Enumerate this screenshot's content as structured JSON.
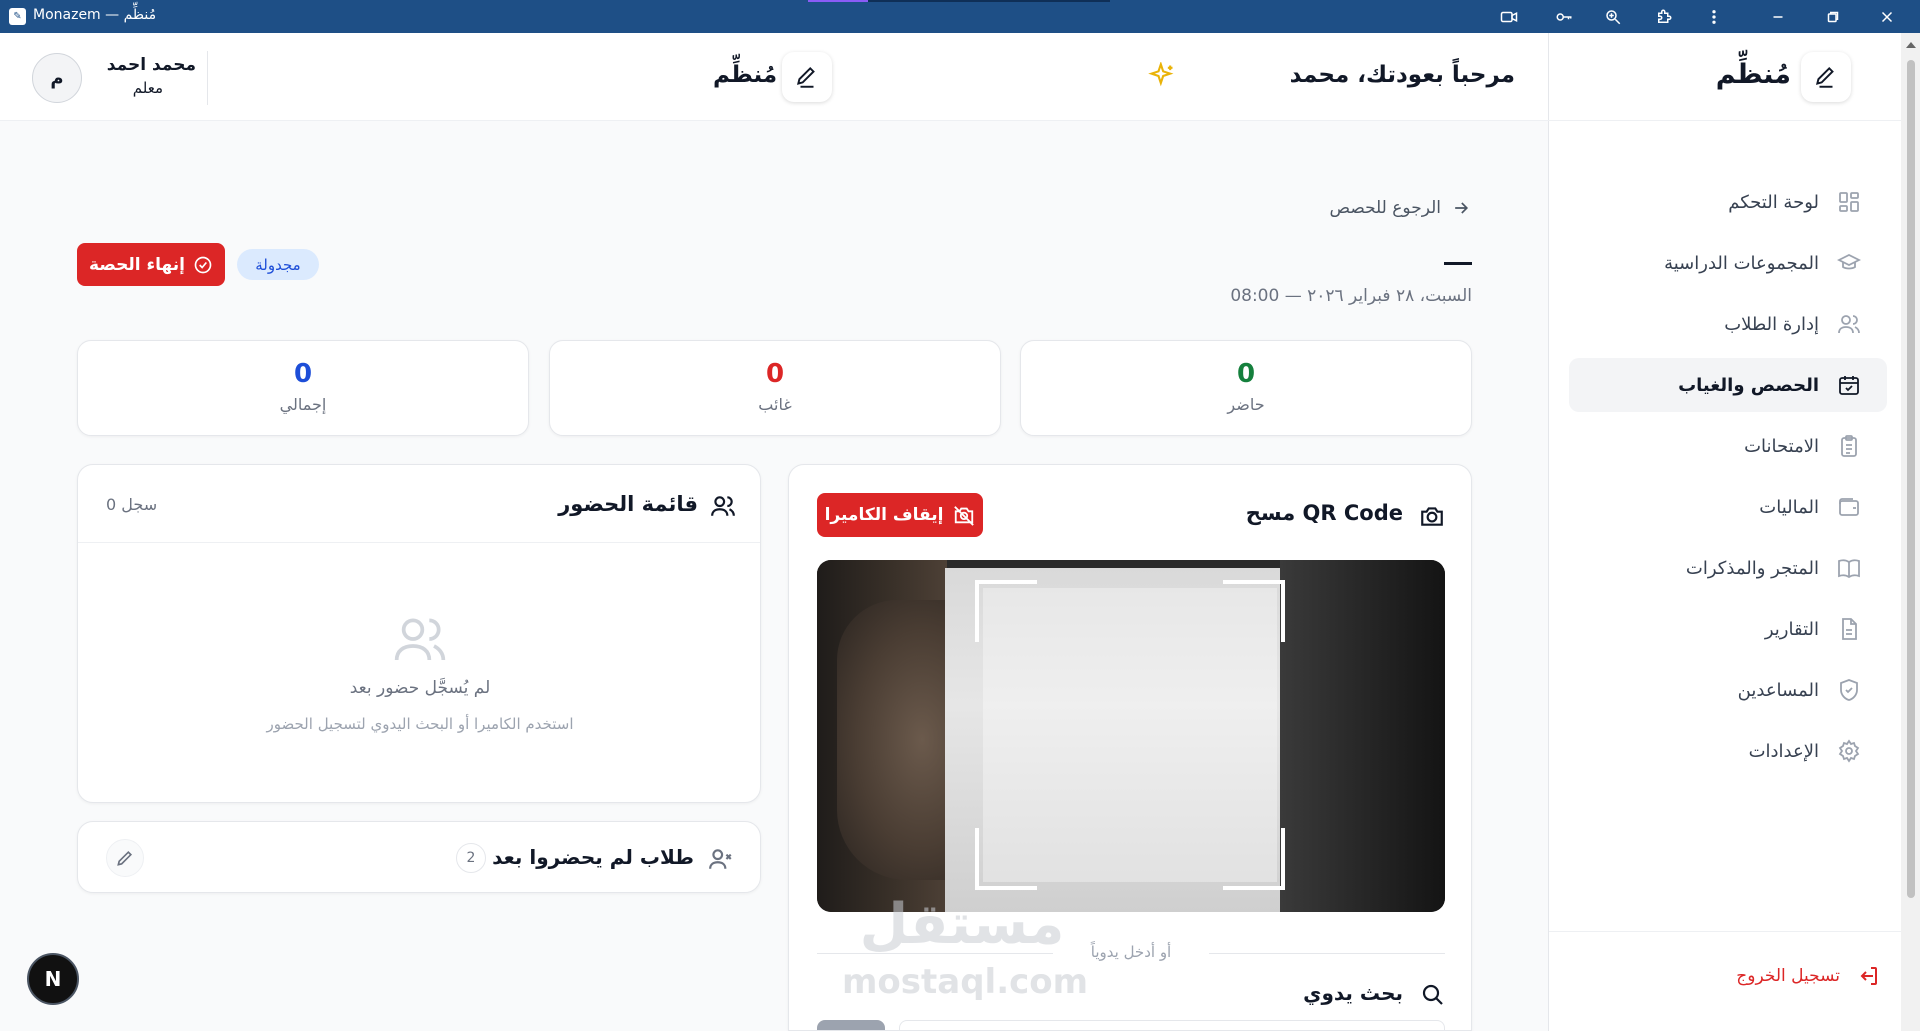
{
  "window": {
    "title": "Monazem — مُنظِّم",
    "icons": [
      "camera-icon",
      "key-icon",
      "zoom-icon",
      "extensions-icon",
      "more-icon",
      "minimize-icon",
      "restore-icon",
      "close-icon"
    ]
  },
  "sidebar": {
    "brand_name": "مُنظِّم",
    "items": [
      {
        "label": "لوحة التحكم",
        "icon": "dashboard-icon",
        "active": false
      },
      {
        "label": "المجموعات الدراسية",
        "icon": "graduation-cap-icon",
        "active": false
      },
      {
        "label": "إدارة الطلاب",
        "icon": "users-icon",
        "active": false
      },
      {
        "label": "الحصص والغياب",
        "icon": "calendar-check-icon",
        "active": true
      },
      {
        "label": "الامتحانات",
        "icon": "clipboard-icon",
        "active": false
      },
      {
        "label": "الماليات",
        "icon": "wallet-icon",
        "active": false
      },
      {
        "label": "المتجر والمذكرات",
        "icon": "book-icon",
        "active": false
      },
      {
        "label": "التقارير",
        "icon": "file-icon",
        "active": false
      },
      {
        "label": "المساعدين",
        "icon": "shield-icon",
        "active": false
      },
      {
        "label": "الإعدادات",
        "icon": "settings-icon",
        "active": false
      }
    ],
    "logout_label": "تسجيل الخروج"
  },
  "header": {
    "welcome": "مرحباً بعودتك، محمد",
    "brand_name": "مُنظِّم",
    "user": {
      "initial": "م",
      "name": "محمد احمد",
      "role": "معلم"
    }
  },
  "session": {
    "back_label": "الرجوع للحصص",
    "title": "—",
    "date_line": "السبت، ٢٨ فبراير ٢٠٢٦ — 08:00",
    "status_badge": "مجدولة",
    "end_button": "إنهاء الحصة"
  },
  "stats": {
    "present": {
      "value": "0",
      "label": "حاضر",
      "color": "#15803d"
    },
    "absent": {
      "value": "0",
      "label": "غائب",
      "color": "#dc2626"
    },
    "total": {
      "value": "0",
      "label": "إجمالي",
      "color": "#1d4ed8"
    }
  },
  "scanner": {
    "title": "مسح QR Code",
    "stop_button": "إيقاف الكاميرا",
    "divider": "أو أدخل يدوياً",
    "manual_title": "بحث يدوي"
  },
  "attendance": {
    "title": "قائمة الحضور",
    "count": "0 سجل",
    "empty_title": "لم يُسجَّل حضور بعد",
    "empty_subtitle": "استخدم الكاميرا أو البحث اليدوي لتسجيل الحضور"
  },
  "not_attended": {
    "title": "طلاب لم يحضروا بعد",
    "count": "2"
  },
  "overlay": {
    "next_badge": "N",
    "watermark_ar": "مستقل",
    "watermark_en": "mostaql.com"
  }
}
